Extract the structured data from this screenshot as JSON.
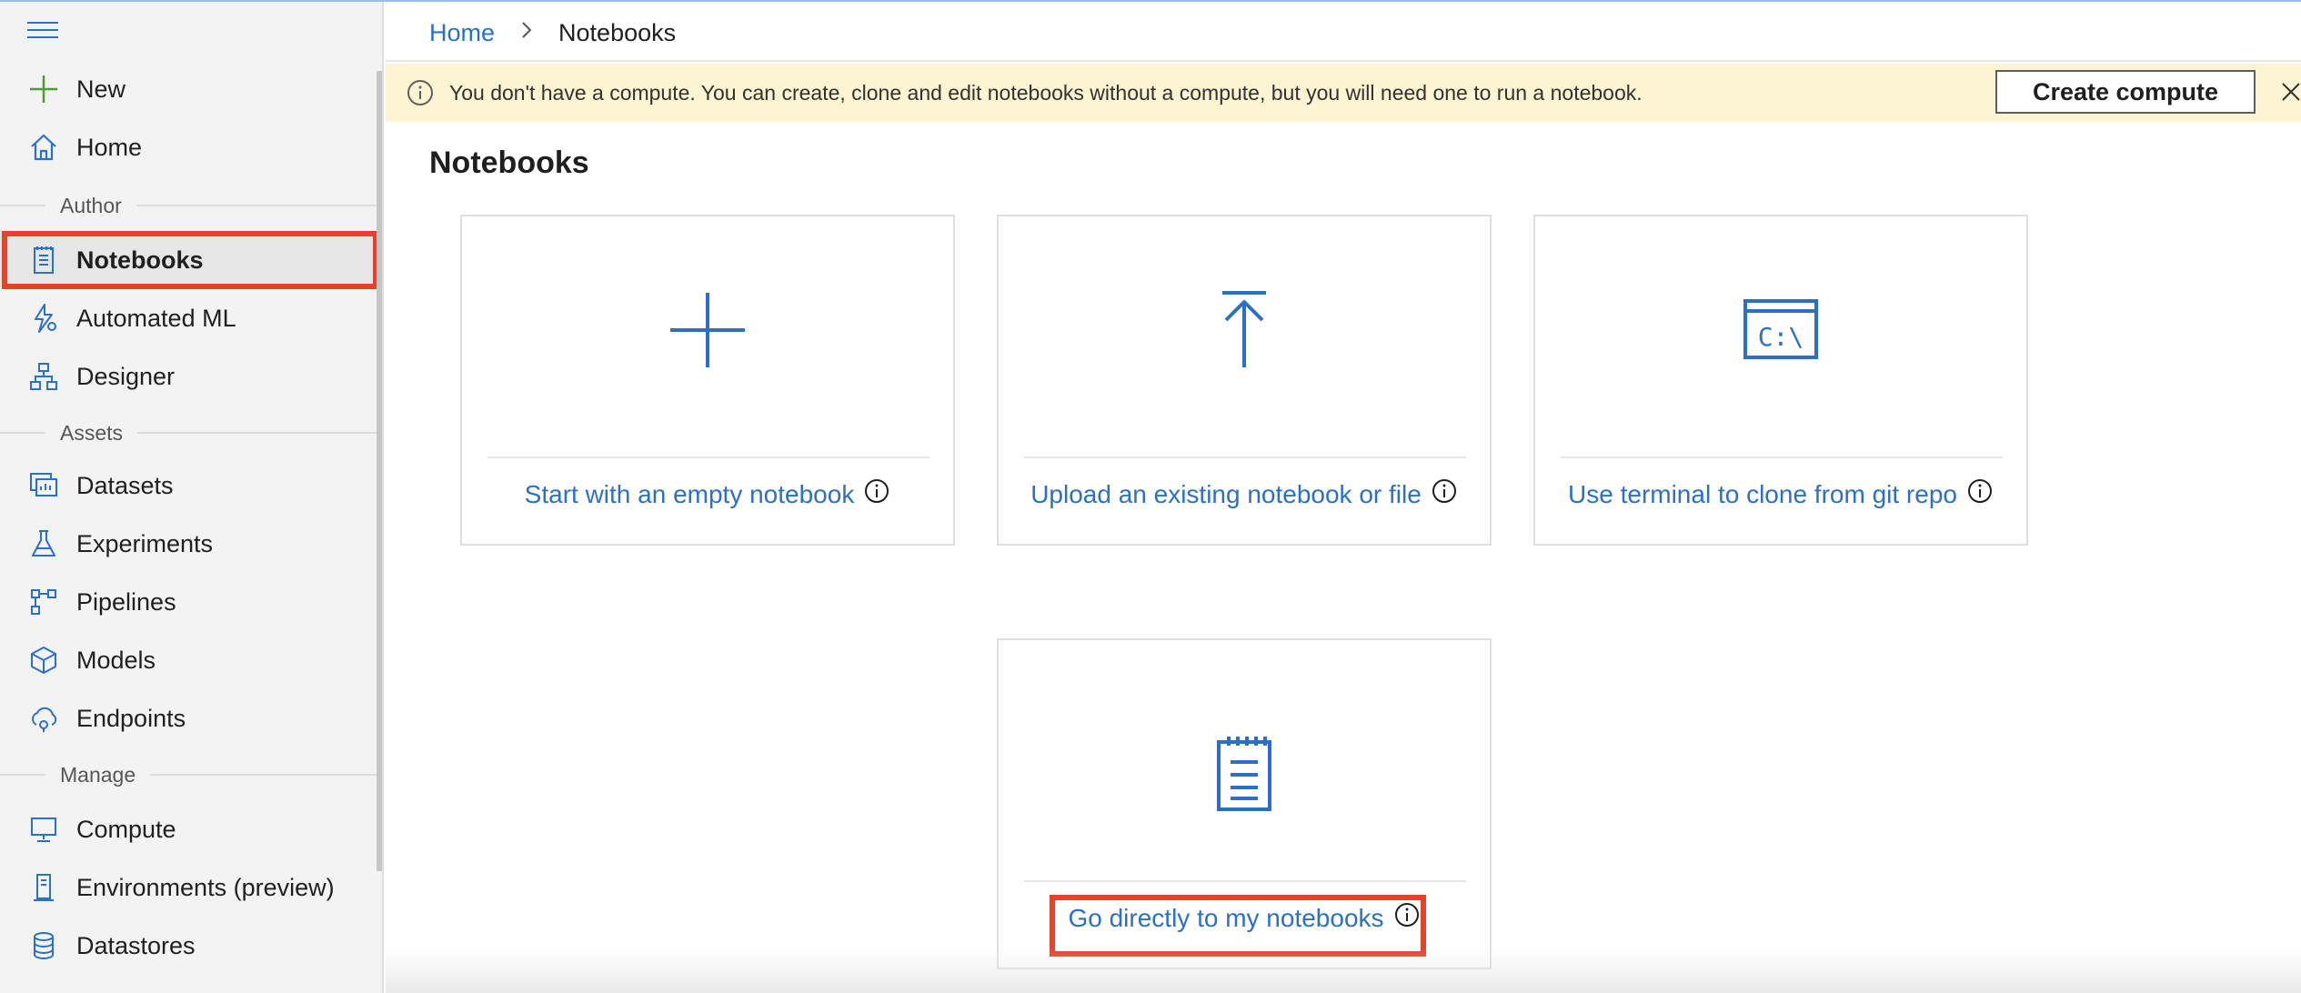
{
  "sidebar": {
    "new_label": "New",
    "home_label": "Home",
    "sections": {
      "author": "Author",
      "assets": "Assets",
      "manage": "Manage"
    },
    "author_items": [
      "Notebooks",
      "Automated ML",
      "Designer"
    ],
    "asset_items": [
      "Datasets",
      "Experiments",
      "Pipelines",
      "Models",
      "Endpoints"
    ],
    "manage_items": [
      "Compute",
      "Environments (preview)",
      "Datastores"
    ],
    "active_item": "Notebooks"
  },
  "breadcrumb": {
    "home": "Home",
    "current": "Notebooks"
  },
  "banner": {
    "message": "You don't have a compute. You can create, clone and edit notebooks without a compute, but you will need one to run a notebook.",
    "button_label": "Create compute"
  },
  "page": {
    "title": "Notebooks"
  },
  "cards": [
    {
      "label": "Start with an empty notebook",
      "icon": "plus-icon"
    },
    {
      "label": "Upload an existing notebook or file",
      "icon": "upload-icon"
    },
    {
      "label": "Use terminal to clone from git repo",
      "icon": "terminal-icon"
    },
    {
      "label": "Go directly to my notebooks",
      "icon": "notepad-icon"
    }
  ],
  "terminal_icon_text": "C:\\",
  "colors": {
    "accent": "#2b6fc7",
    "highlight_outline": "#e8402b",
    "banner_bg": "#fcf4d2",
    "sidebar_bg": "#f3f3f3"
  }
}
